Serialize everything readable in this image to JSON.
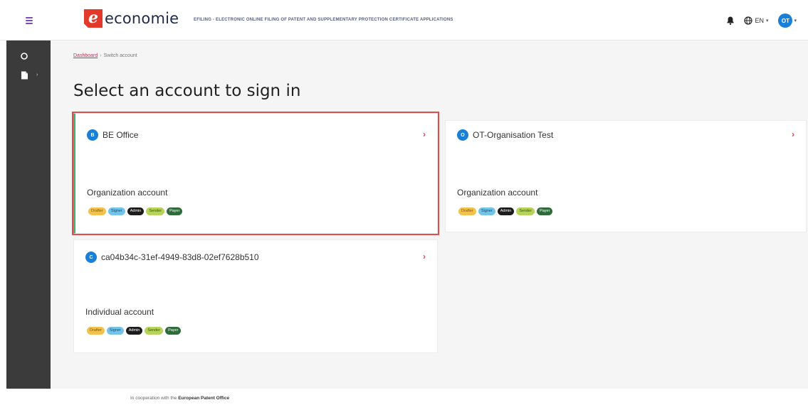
{
  "header": {
    "logo_text": "economie",
    "app_title": "EFILING - ELECTRONIC ONLINE FILING OF PATENT AND SUPPLEMENTARY PROTECTION CERTIFICATE APPLICATIONS",
    "language": "EN",
    "user_initials": "OT"
  },
  "breadcrumb": {
    "home": "Dashboard",
    "separator": "›",
    "current": "Switch account"
  },
  "page_title": "Select an account to sign in",
  "accounts": [
    {
      "initial": "B",
      "name": "BE Office",
      "type": "Organization account",
      "selected": true
    },
    {
      "initial": "O",
      "name": "OT-Organisation Test",
      "type": "Organization account",
      "selected": false
    },
    {
      "initial": "C",
      "name": "ca04b34c-31ef-4949-83d8-02ef7628b510",
      "type": "Individual account",
      "selected": false
    }
  ],
  "roles": [
    "Drafter",
    "Signer",
    "Admin",
    "Sender",
    "Payer"
  ],
  "role_colors": {
    "Drafter": "#f2c14e",
    "Signer": "#74c3e8",
    "Admin": "#1c1c1c",
    "Sender": "#b6d35a",
    "Payer": "#2f6b3a"
  },
  "colors": {
    "accent": "#1a7fd6",
    "selected_border": "#e14c4c",
    "selected_stripe": "#40b578",
    "chevron": "#d4465a",
    "sidebar": "#3b3b3b"
  },
  "footer": {
    "prefix": "In cooperation with the",
    "org": "European Patent Office"
  },
  "icons": {
    "menu": "hamburger-icon",
    "notifications": "bell-icon",
    "language": "globe-icon",
    "sidebar_1": "refresh-icon",
    "sidebar_2": "document-icon"
  }
}
